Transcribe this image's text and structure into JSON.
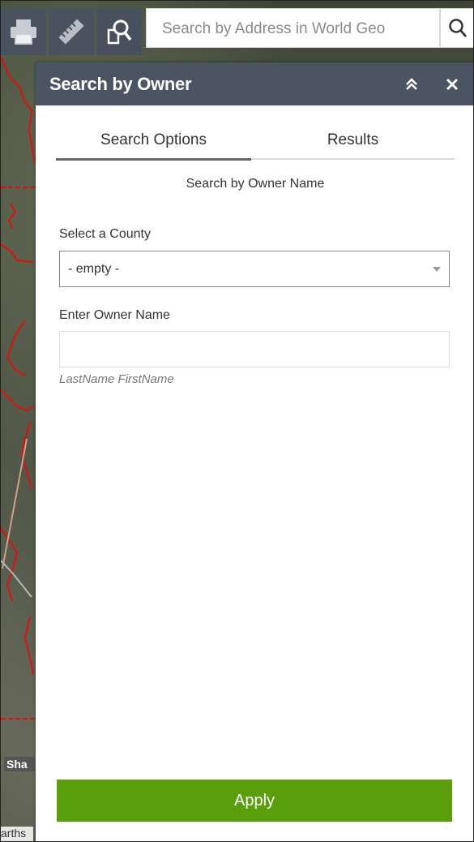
{
  "toolbar": {
    "print_icon": "print-icon",
    "measure_icon": "ruler-icon",
    "search_owner_icon": "document-search-icon",
    "search_placeholder": "Search by Address in World Geo",
    "search_button_icon": "search-icon"
  },
  "panel": {
    "title": "Search by Owner",
    "collapse_icon": "double-chevron-up-icon",
    "close_icon": "close-icon",
    "tabs": [
      {
        "label": "Search Options",
        "active": true
      },
      {
        "label": "Results",
        "active": false
      }
    ],
    "subtitle": "Search by Owner Name",
    "county_label": "Select a County",
    "county_value": "- empty -",
    "owner_label": "Enter Owner Name",
    "owner_value": "",
    "owner_hint": "LastName FirstName",
    "apply_label": "Apply"
  },
  "map": {
    "place_label": "Sha",
    "attribution": "arths"
  },
  "colors": {
    "header": "#4b5463",
    "toolbar": "#4a5260",
    "apply": "#5a9e0e",
    "boundary": "#e01010"
  }
}
